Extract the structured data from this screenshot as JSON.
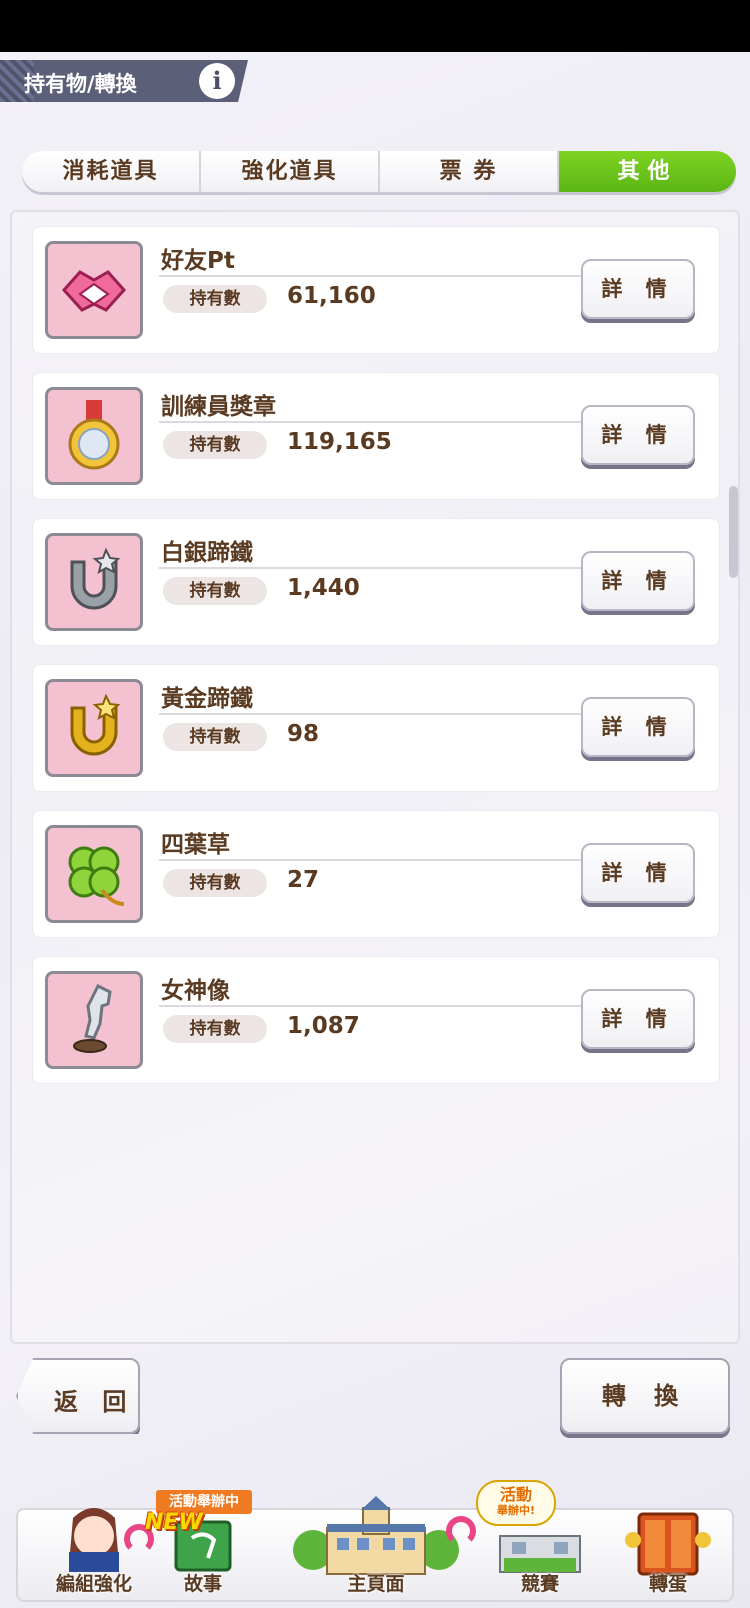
{
  "header": {
    "title": "持有物/轉換",
    "info_icon": "info-icon"
  },
  "tabs": [
    {
      "label": "消耗道具",
      "active": false
    },
    {
      "label": "強化道具",
      "active": false
    },
    {
      "label": "票 券",
      "active": false
    },
    {
      "label": "其他",
      "active": true
    }
  ],
  "items": [
    {
      "name": "好友Pt",
      "own_label": "持有數",
      "value": "61,160",
      "detail_label": "詳 情",
      "icon": "handshake-icon"
    },
    {
      "name": "訓練員獎章",
      "own_label": "持有數",
      "value": "119,165",
      "detail_label": "詳 情",
      "icon": "medal-icon"
    },
    {
      "name": "白銀蹄鐵",
      "own_label": "持有數",
      "value": "1,440",
      "detail_label": "詳 情",
      "icon": "silver-horseshoe-icon"
    },
    {
      "name": "黃金蹄鐵",
      "own_label": "持有數",
      "value": "98",
      "detail_label": "詳 情",
      "icon": "gold-horseshoe-icon"
    },
    {
      "name": "四葉草",
      "own_label": "持有數",
      "value": "27",
      "detail_label": "詳 情",
      "icon": "clover-icon"
    },
    {
      "name": "女神像",
      "own_label": "持有數",
      "value": "1,087",
      "detail_label": "詳 情",
      "icon": "statue-icon"
    }
  ],
  "actions": {
    "back": "返 回",
    "convert": "轉 換"
  },
  "nav": {
    "team": "編組強化",
    "story": "故事",
    "home": "主頁面",
    "race": "競賽",
    "gacha": "轉蛋",
    "event_badge": "活動舉辦中",
    "new_badge": "NEW",
    "race_bubble_1": "活動",
    "race_bubble_2": "舉辦中!"
  }
}
